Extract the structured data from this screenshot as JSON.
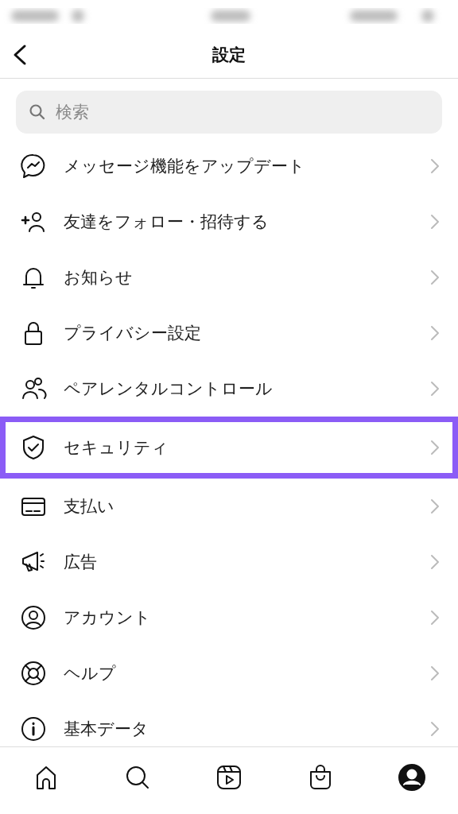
{
  "header": {
    "title": "設定"
  },
  "search": {
    "placeholder": "検索"
  },
  "items": [
    {
      "label": "メッセージ機能をアップデート",
      "highlighted": false
    },
    {
      "label": "友達をフォロー・招待する",
      "highlighted": false
    },
    {
      "label": "お知らせ",
      "highlighted": false
    },
    {
      "label": "プライバシー設定",
      "highlighted": false
    },
    {
      "label": "ペアレンタルコントロール",
      "highlighted": false
    },
    {
      "label": "セキュリティ",
      "highlighted": true
    },
    {
      "label": "支払い",
      "highlighted": false
    },
    {
      "label": "広告",
      "highlighted": false
    },
    {
      "label": "アカウント",
      "highlighted": false
    },
    {
      "label": "ヘルプ",
      "highlighted": false
    },
    {
      "label": "基本データ",
      "highlighted": false
    }
  ],
  "nav_tabs": [
    {
      "selected": false
    },
    {
      "selected": false
    },
    {
      "selected": false
    },
    {
      "selected": false
    },
    {
      "selected": true
    }
  ]
}
